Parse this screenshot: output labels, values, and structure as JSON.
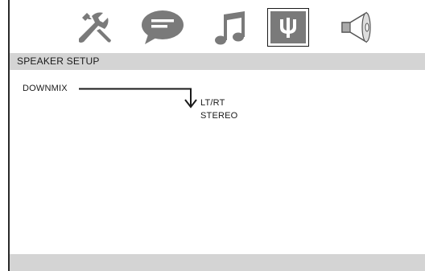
{
  "tabs": [
    {
      "icon": "wrench-tools-icon",
      "name": "general-setup"
    },
    {
      "icon": "speech-bubble-icon",
      "name": "language-setup"
    },
    {
      "icon": "music-note-icon",
      "name": "audio-setup"
    },
    {
      "icon": "speaker-plug-icon",
      "name": "speaker-setup",
      "active": true
    },
    {
      "icon": "loudspeaker-icon",
      "name": "volume-setup"
    }
  ],
  "header": {
    "title": "SPEAKER SETUP"
  },
  "menu": {
    "item_label": "DOWNMIX"
  },
  "options": [
    "LT/RT",
    "STEREO"
  ],
  "colors": {
    "header_bg": "#d4d4d4",
    "icon_gray": "#7a7a7a",
    "active_tab_bg": "#7a7a7a",
    "text": "#1a1a1a"
  }
}
